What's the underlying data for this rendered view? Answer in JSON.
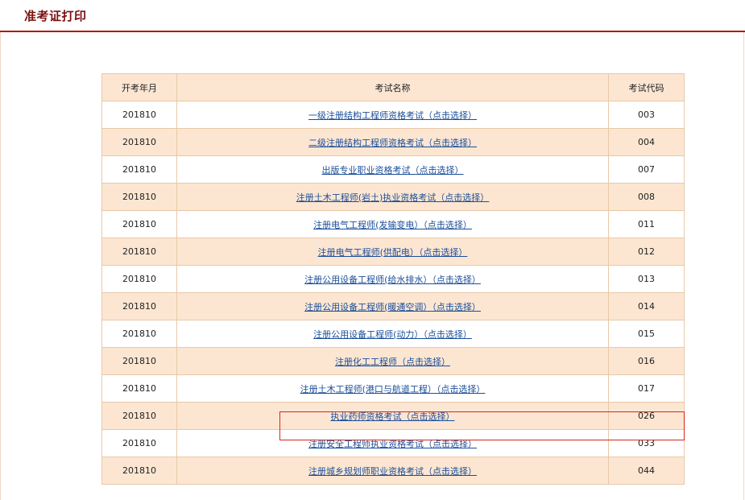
{
  "header": {
    "title": "准考证打印"
  },
  "table": {
    "headers": [
      "开考年月",
      "考试名称",
      "考试代码"
    ],
    "rows": [
      {
        "date": "201810",
        "name": "一级注册结构工程师资格考试（点击选择）",
        "code": "003"
      },
      {
        "date": "201810",
        "name": "二级注册结构工程师资格考试（点击选择）",
        "code": "004"
      },
      {
        "date": "201810",
        "name": "出版专业职业资格考试（点击选择）",
        "code": "007"
      },
      {
        "date": "201810",
        "name": "注册土木工程师(岩土)执业资格考试（点击选择）",
        "code": "008"
      },
      {
        "date": "201810",
        "name": "注册电气工程师(发输变电）（点击选择）",
        "code": "011"
      },
      {
        "date": "201810",
        "name": "注册电气工程师(供配电）（点击选择）",
        "code": "012"
      },
      {
        "date": "201810",
        "name": "注册公用设备工程师(给水排水）（点击选择）",
        "code": "013"
      },
      {
        "date": "201810",
        "name": "注册公用设备工程师(暖通空调）（点击选择）",
        "code": "014"
      },
      {
        "date": "201810",
        "name": "注册公用设备工程师(动力）（点击选择）",
        "code": "015"
      },
      {
        "date": "201810",
        "name": "注册化工工程师（点击选择）",
        "code": "016"
      },
      {
        "date": "201810",
        "name": "注册土木工程师(港口与航道工程）（点击选择）",
        "code": "017"
      },
      {
        "date": "201810",
        "name": "执业药师资格考试（点击选择）",
        "code": "026"
      },
      {
        "date": "201810",
        "name": "注册安全工程师执业资格考试（点击选择）",
        "code": "033"
      },
      {
        "date": "201810",
        "name": "注册城乡规划师职业资格考试（点击选择）",
        "code": "044"
      }
    ]
  },
  "colors": {
    "accent": "#b21a0e",
    "title": "#7b1010",
    "row_alt": "#fce6d2",
    "link": "#1a4e9a",
    "highlight": "#d9251c"
  }
}
